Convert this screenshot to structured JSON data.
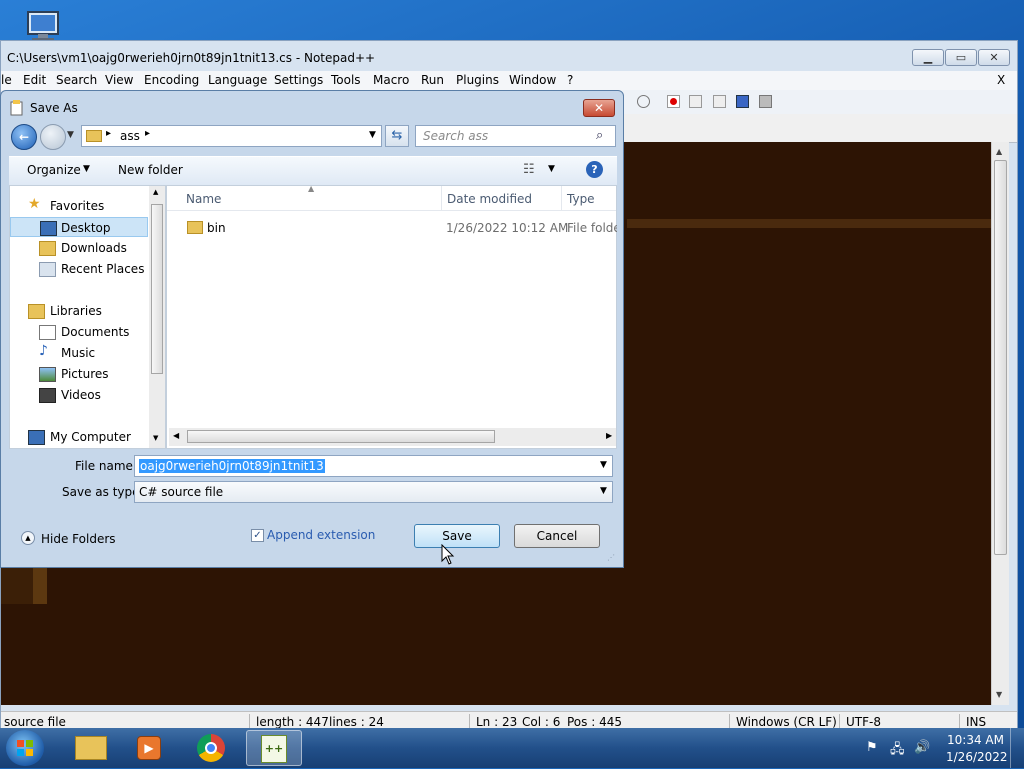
{
  "notepad": {
    "title": "C:\\Users\\vm1\\oajg0rwerieh0jrn0t89jn1tnit13.cs - Notepad++",
    "menu": [
      "le",
      "Edit",
      "Search",
      "View",
      "Encoding",
      "Language",
      "Settings",
      "Tools",
      "Macro",
      "Run",
      "Plugins",
      "Window",
      "?"
    ],
    "menu_close": "X",
    "status": {
      "type": "source file",
      "length": "length : 447",
      "lines": "lines : 24",
      "ln": "Ln : 23",
      "col": "Col : 6",
      "pos": "Pos : 445",
      "eol": "Windows (CR LF)",
      "encoding": "UTF-8",
      "mode": "INS"
    }
  },
  "dialog": {
    "title": "Save As",
    "breadcrumb": [
      "ass"
    ],
    "search_placeholder": "Search ass",
    "organize_label": "Organize",
    "new_folder_label": "New folder",
    "nav": {
      "favorites_label": "Favorites",
      "favorites": [
        "Desktop",
        "Downloads",
        "Recent Places"
      ],
      "libraries_label": "Libraries",
      "libraries": [
        "Documents",
        "Music",
        "Pictures",
        "Videos"
      ],
      "computer_label": "My Computer"
    },
    "columns": {
      "name": "Name",
      "date": "Date modified",
      "type": "Type"
    },
    "files": [
      {
        "name": "bin",
        "date": "1/26/2022 10:12 AM",
        "type": "File folder"
      }
    ],
    "file_name_label": "File name:",
    "file_name_value": "oajg0rwerieh0jrn0t89jn1tnit13",
    "save_type_label": "Save as type:",
    "save_type_value": "C# source file",
    "append_extension_label": "Append extension",
    "append_extension_checked": true,
    "hide_folders_label": "Hide Folders",
    "save_label": "Save",
    "cancel_label": "Cancel"
  },
  "taskbar": {
    "time": "10:34 AM",
    "date": "1/26/2022"
  },
  "colors": {
    "editor_bg": "#2d1404",
    "selection": "#3399ff",
    "desktop": "#1b66b8"
  }
}
